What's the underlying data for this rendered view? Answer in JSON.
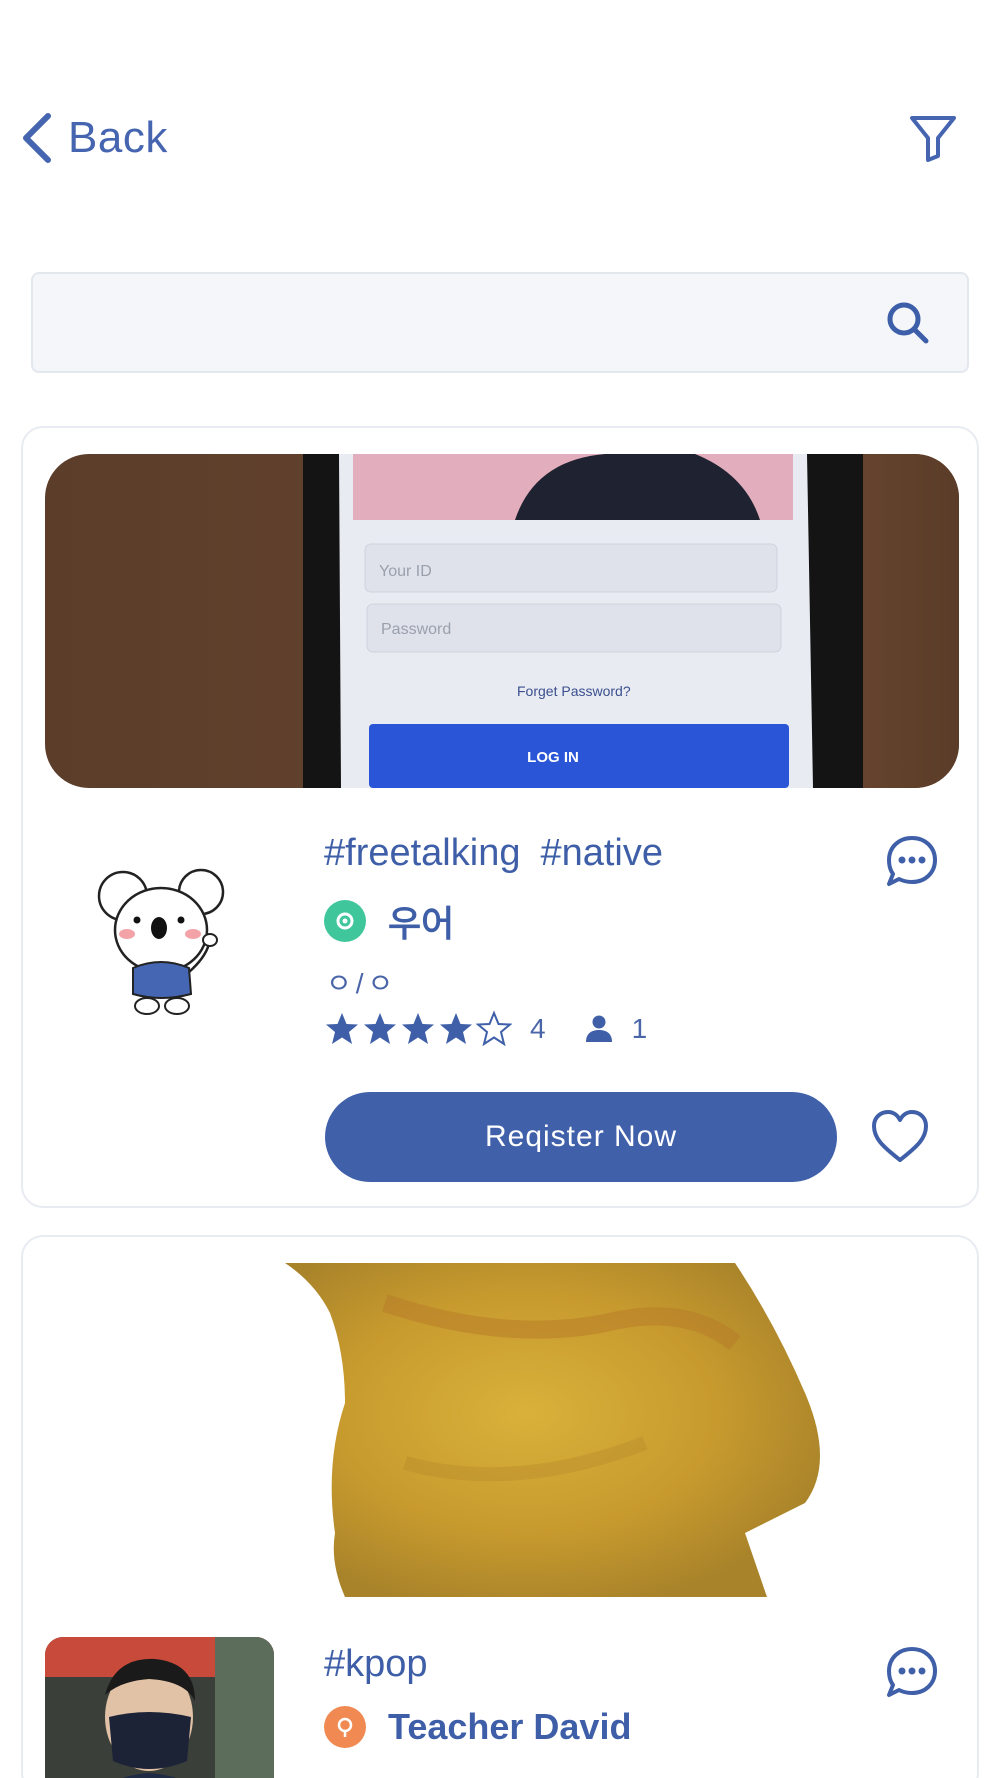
{
  "header": {
    "back_label": "Back"
  },
  "search": {
    "placeholder": ""
  },
  "cards": [
    {
      "tags": [
        "#freetalking",
        "#native"
      ],
      "teacher_name": "우어",
      "schedule": "ㅇ/ㅇ",
      "rating_stars": 4,
      "rating_label": "4",
      "participants": "1",
      "register_label": "Reqister Now",
      "hero_image_text": {
        "id_placeholder": "Your ID",
        "password_placeholder": "Password",
        "forgot": "Forget Password?",
        "login": "LOG IN"
      }
    },
    {
      "tags": [
        "#kpop"
      ],
      "teacher_name": "Teacher David"
    }
  ],
  "colors": {
    "brand": "#3f5fa8",
    "search_bg": "#f4f6fa",
    "badge_green": "#3fc79b",
    "badge_orange": "#f08a52"
  },
  "icons": [
    "chevron-left-icon",
    "filter-icon",
    "search-icon",
    "chat-icon",
    "star-icon",
    "person-icon",
    "heart-icon"
  ]
}
